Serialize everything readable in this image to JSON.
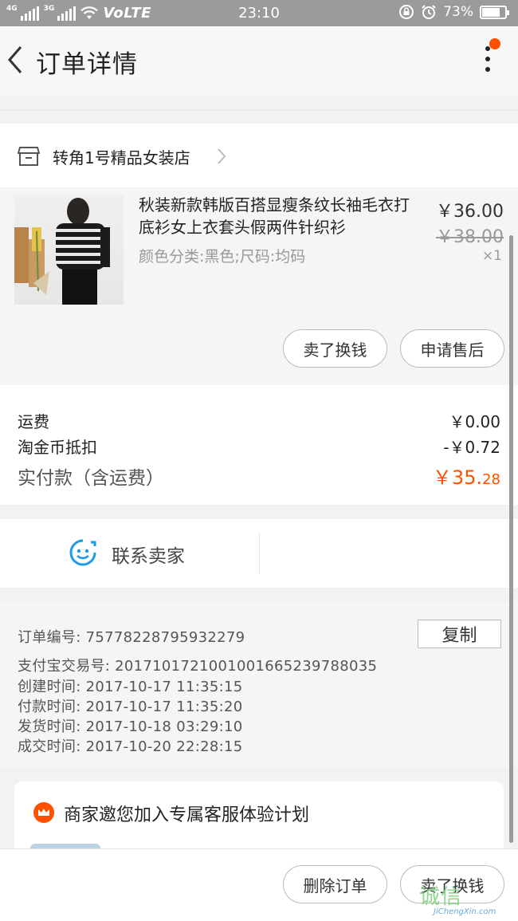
{
  "status_bar": {
    "net1": "4G",
    "net2": "3G",
    "volte": "VoLTE",
    "time": "23:10",
    "battery_percent": "73%",
    "battery_level": 0.73
  },
  "header": {
    "title": "订单详情"
  },
  "shop": {
    "name": "转角1号精品女装店"
  },
  "item": {
    "title": "秋装新款韩版百搭显瘦条纹长袖毛衣打底衫女上衣套头假两件针织衫",
    "sku": "颜色分类:黑色;尺码:均码",
    "price": "￥36.00",
    "original_price": "￥38.00",
    "quantity": "×1",
    "buttons": {
      "sell": "卖了换钱",
      "after_sale": "申请售后"
    }
  },
  "cost": {
    "shipping_label": "运费",
    "shipping_value": "￥0.00",
    "coin_label": "淘金币抵扣",
    "coin_value": "-￥0.72",
    "total_label": "实付款（含运费）",
    "total_main": "￥35.",
    "total_decimal": "28"
  },
  "contact": {
    "label": "联系卖家"
  },
  "order_info": {
    "order_no_label": "订单编号:",
    "order_no": "75778228795932279",
    "copy_label": "复制",
    "alipay_label": "支付宝交易号:",
    "alipay_no": "2017101721001001665239788035",
    "created_label": "创建时间:",
    "created": "2017-10-17 11:35:15",
    "paid_label": "付款时间:",
    "paid": "2017-10-17 11:35:20",
    "shipped_label": "发货时间:",
    "shipped": "2017-10-18 03:29:10",
    "completed_label": "成交时间:",
    "completed": "2017-10-20 22:28:15"
  },
  "invite": {
    "text": "商家邀您加入专属客服体验计划"
  },
  "bottom_bar": {
    "delete_label": "删除订单",
    "sell_label": "卖了换钱"
  },
  "watermark": {
    "main": "诚信",
    "sub": "JiChengXin.com"
  },
  "colors": {
    "accent": "#ff5000",
    "contact_blue": "#1e9be8",
    "status_bar": "#9b9b9b"
  }
}
